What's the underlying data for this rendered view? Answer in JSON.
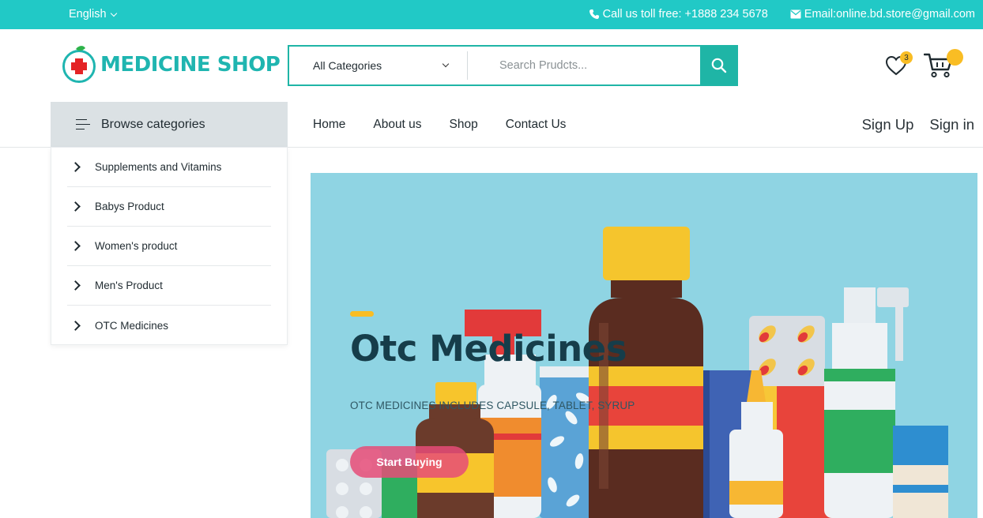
{
  "topbar": {
    "language": "English",
    "phone_text": "Call us toll free: +1888 234 5678",
    "email_text": "Email:online.bd.store@gmail.com",
    "background": "#21c9c6"
  },
  "header": {
    "logo_text": "MEDICINE SHOP",
    "search": {
      "category_selected": "All Categories",
      "placeholder": "Search Prudcts..."
    },
    "wishlist_count": "3",
    "accent": "#1fb5a6",
    "badge_color": "#f9bd24"
  },
  "nav": {
    "browse_label": "Browse categories",
    "links": [
      "Home",
      "About us",
      "Shop",
      "Contact Us"
    ],
    "sign_up": "Sign Up",
    "sign_in": "Sign in"
  },
  "categories": [
    "Supplements and Vitamins",
    "Babys Product",
    "Women's product",
    "Men's Product",
    "OTC Medicines"
  ],
  "hero": {
    "title": "Otc Medicines",
    "subtitle": "OTC MEDICINES INCLUDES CAPSULE, TABLET, SYRUP",
    "button": "Start Buying",
    "background": "#8fd4e3"
  },
  "icons": {
    "language": "chevron-down-icon",
    "phone": "phone-icon",
    "email": "envelope-icon",
    "search": "search-icon",
    "wishlist": "heart-icon",
    "cart": "cart-icon",
    "browse": "menu-icon",
    "category": "chevron-right-icon"
  }
}
